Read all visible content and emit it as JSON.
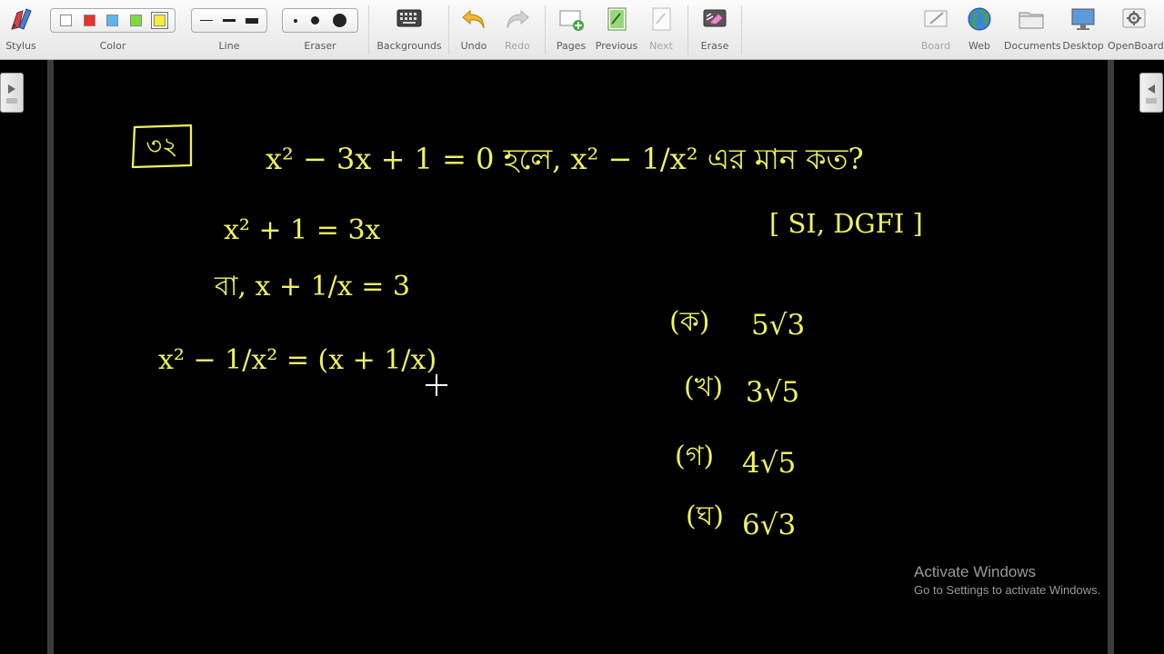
{
  "toolbar": {
    "stylus": "Stylus",
    "color": "Color",
    "line": "Line",
    "eraser": "Eraser",
    "backgrounds": "Backgrounds",
    "undo": "Undo",
    "redo": "Redo",
    "pages": "Pages",
    "previous": "Previous",
    "next": "Next",
    "erase": "Erase",
    "board": "Board",
    "web": "Web",
    "documents": "Documents",
    "desktop": "Desktop",
    "openboard": "OpenBoard",
    "colors": [
      "#ffffff",
      "#e8322b",
      "#59b8f0",
      "#7bdc3b",
      "#f6ee35"
    ],
    "selected_color": "#f6ee35"
  },
  "board": {
    "ink_color": "#f1f45a",
    "background": "#000000",
    "question_number": "৩২",
    "question": "x² − 3x + 1 = 0 হলে, x² − 1/x² এর মান কত?",
    "reference": "[ SI, DGFI ]",
    "work": [
      "x² + 1 = 3x",
      "বা, x + 1/x = 3",
      "x² − 1/x² = (x + 1/x)"
    ],
    "options": [
      {
        "label": "(ক)",
        "value": "5√3"
      },
      {
        "label": "(খ)",
        "value": "3√5"
      },
      {
        "label": "(গ)",
        "value": "4√5"
      },
      {
        "label": "(ঘ)",
        "value": "6√3"
      }
    ]
  },
  "watermark": {
    "title": "Activate Windows",
    "subtitle": "Go to Settings to activate Windows."
  }
}
